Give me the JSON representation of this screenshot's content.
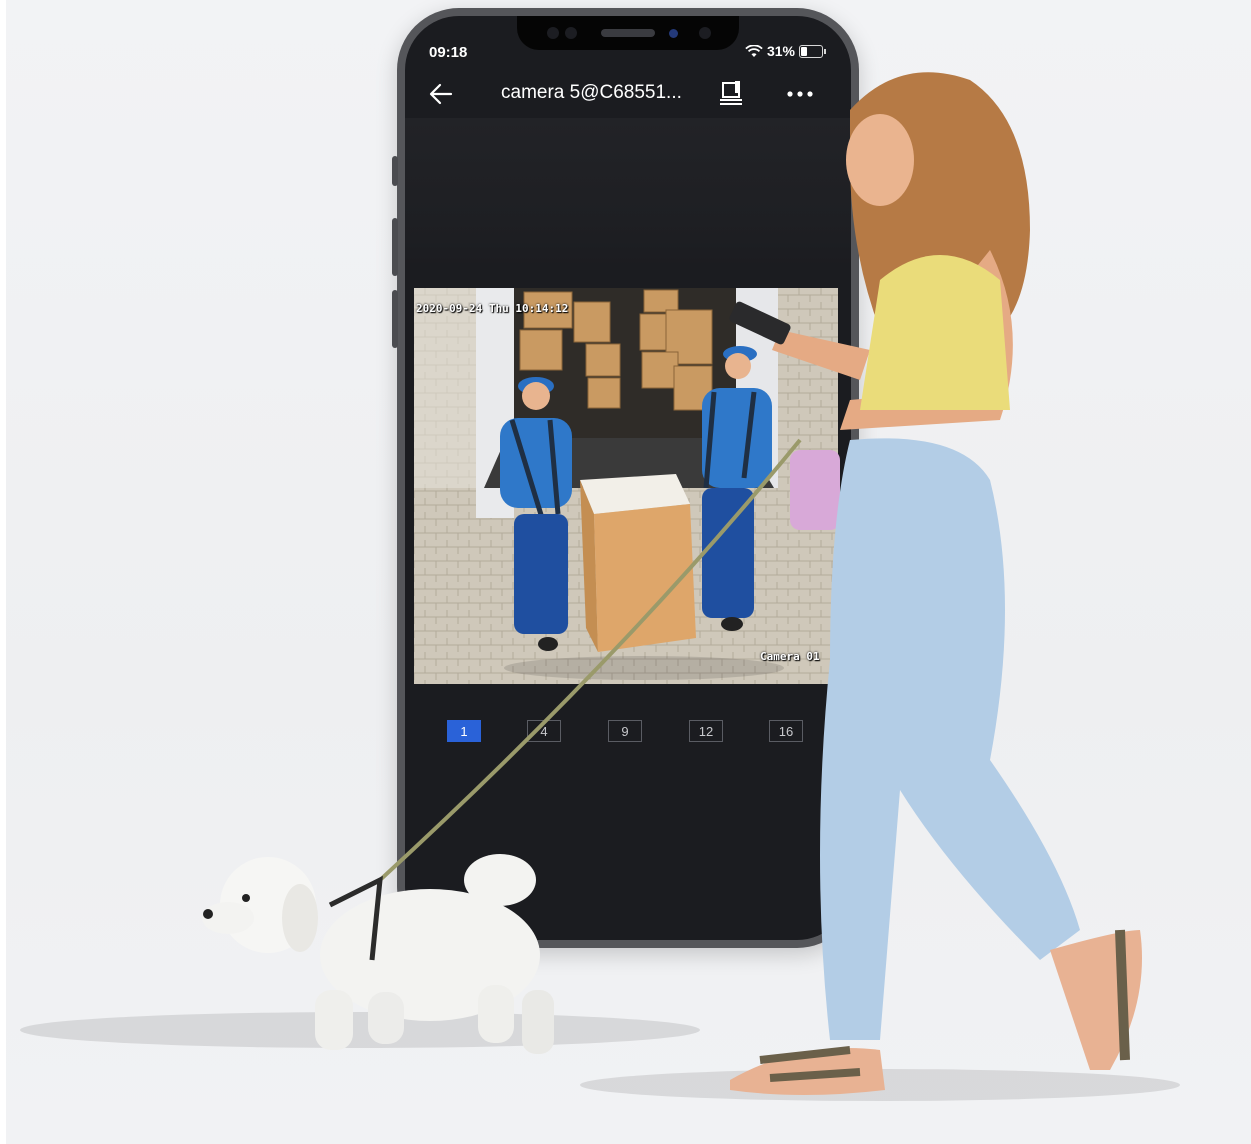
{
  "status_bar": {
    "time": "09:18",
    "battery": "31%",
    "battery_level": 0.31
  },
  "app_bar": {
    "title": "camera 5@C68551...",
    "icons": [
      "back-arrow-icon",
      "recording-icon",
      "more-options-icon"
    ]
  },
  "feed": {
    "timestamp": "2020-09-24 Thu 10:14:12",
    "camera_name": "Camera 01"
  },
  "split_options": [
    "1",
    "4",
    "9",
    "12",
    "16"
  ],
  "active_split": "1",
  "colors": {
    "accent": "#2a62d8",
    "screen_bg": "#1b1c20",
    "page_bg": "#f0f1f3"
  }
}
